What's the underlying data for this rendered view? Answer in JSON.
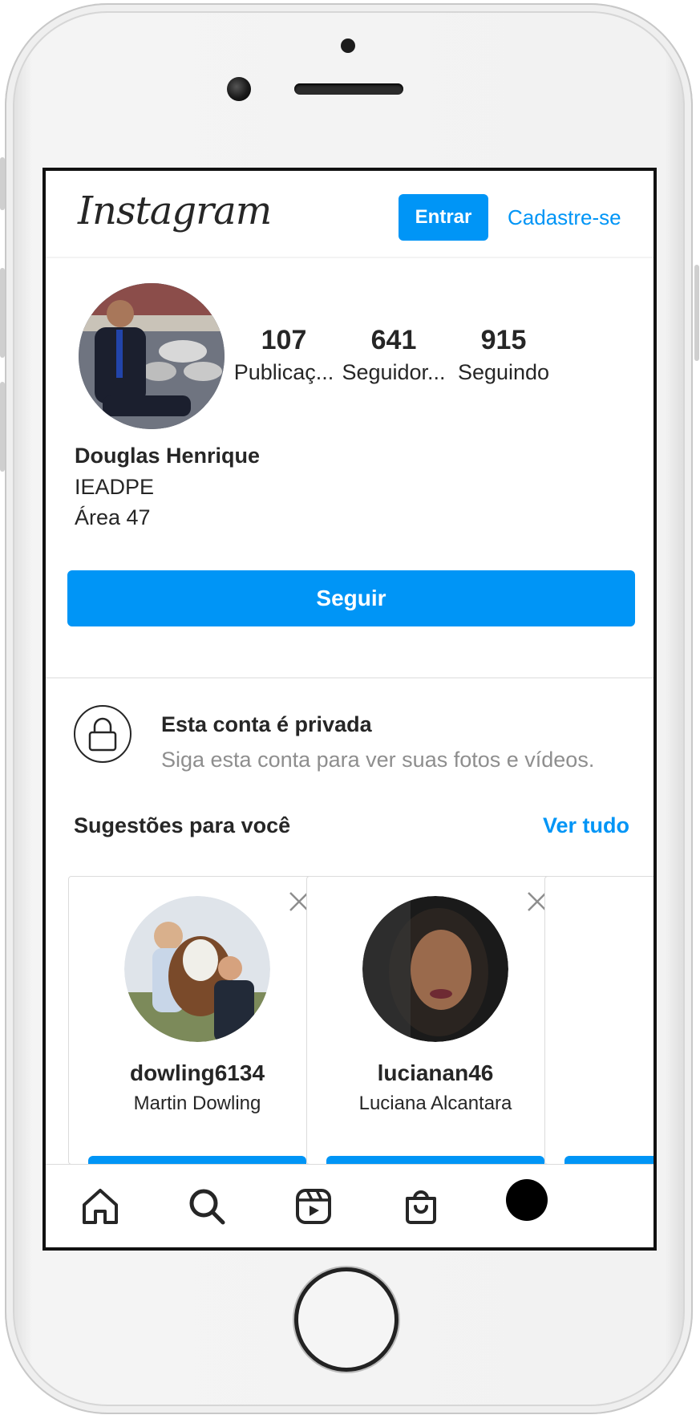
{
  "app": {
    "logo_text": "Instagram",
    "login_label": "Entrar",
    "signup_label": "Cadastre-se"
  },
  "profile": {
    "stats": [
      {
        "value": "107",
        "label": "Publicaç..."
      },
      {
        "value": "641",
        "label": "Seguidor..."
      },
      {
        "value": "915",
        "label": "Seguindo"
      }
    ],
    "name": "Douglas Henrique",
    "bio_lines": [
      "IEADPE",
      "Área 47"
    ],
    "follow_label": "Seguir"
  },
  "private": {
    "title": "Esta conta é privada",
    "subtitle": "Siga esta conta para ver suas fotos e vídeos."
  },
  "suggestions": {
    "title": "Sugestões para você",
    "see_all": "Ver tudo",
    "cards": [
      {
        "username": "dowling6134",
        "full_name": "Martin Dowling"
      },
      {
        "username": "lucianan46",
        "full_name": "Luciana Alcantara"
      }
    ]
  },
  "nav": {
    "items": [
      "home-icon",
      "search-icon",
      "reels-icon",
      "shop-icon",
      "profile-avatar"
    ]
  },
  "colors": {
    "accent": "#0095f6",
    "text": "#262626",
    "muted": "#8e8e8e"
  }
}
